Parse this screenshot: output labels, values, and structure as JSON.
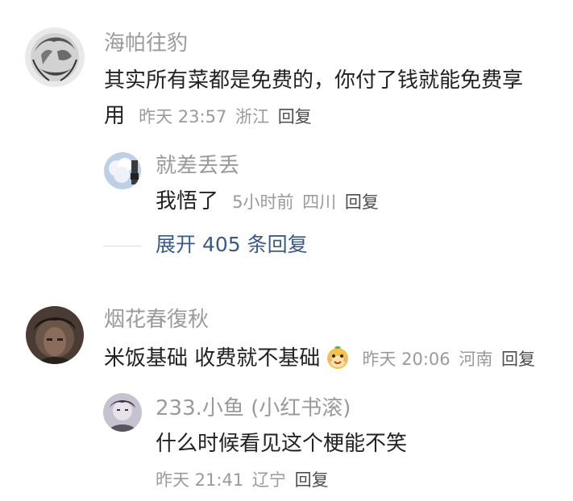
{
  "comments": [
    {
      "user": "海帕往豹",
      "text_line1": "其实所有菜都是免费的，你付了钱就能免费享",
      "text_line2": "用",
      "time": "昨天 23:57",
      "location": "浙江",
      "reply_label": "回复",
      "replies": [
        {
          "user": "就差丢丢",
          "text": "我悟了",
          "time": "5小时前",
          "location": "四川",
          "reply_label": "回复"
        }
      ],
      "expand_label": "展开 405 条回复"
    },
    {
      "user": "烟花春復秋",
      "text": "米饭基础 收费就不基础",
      "emoji": "smiling-face-emoji",
      "time": "昨天 20:06",
      "location": "河南",
      "reply_label": "回复",
      "replies": [
        {
          "user": "233.小鱼 (小红书滚)",
          "text": "什么时候看见这个梗能不笑",
          "time": "昨天 21:41",
          "location": "辽宁",
          "reply_label": "回复"
        }
      ]
    }
  ]
}
